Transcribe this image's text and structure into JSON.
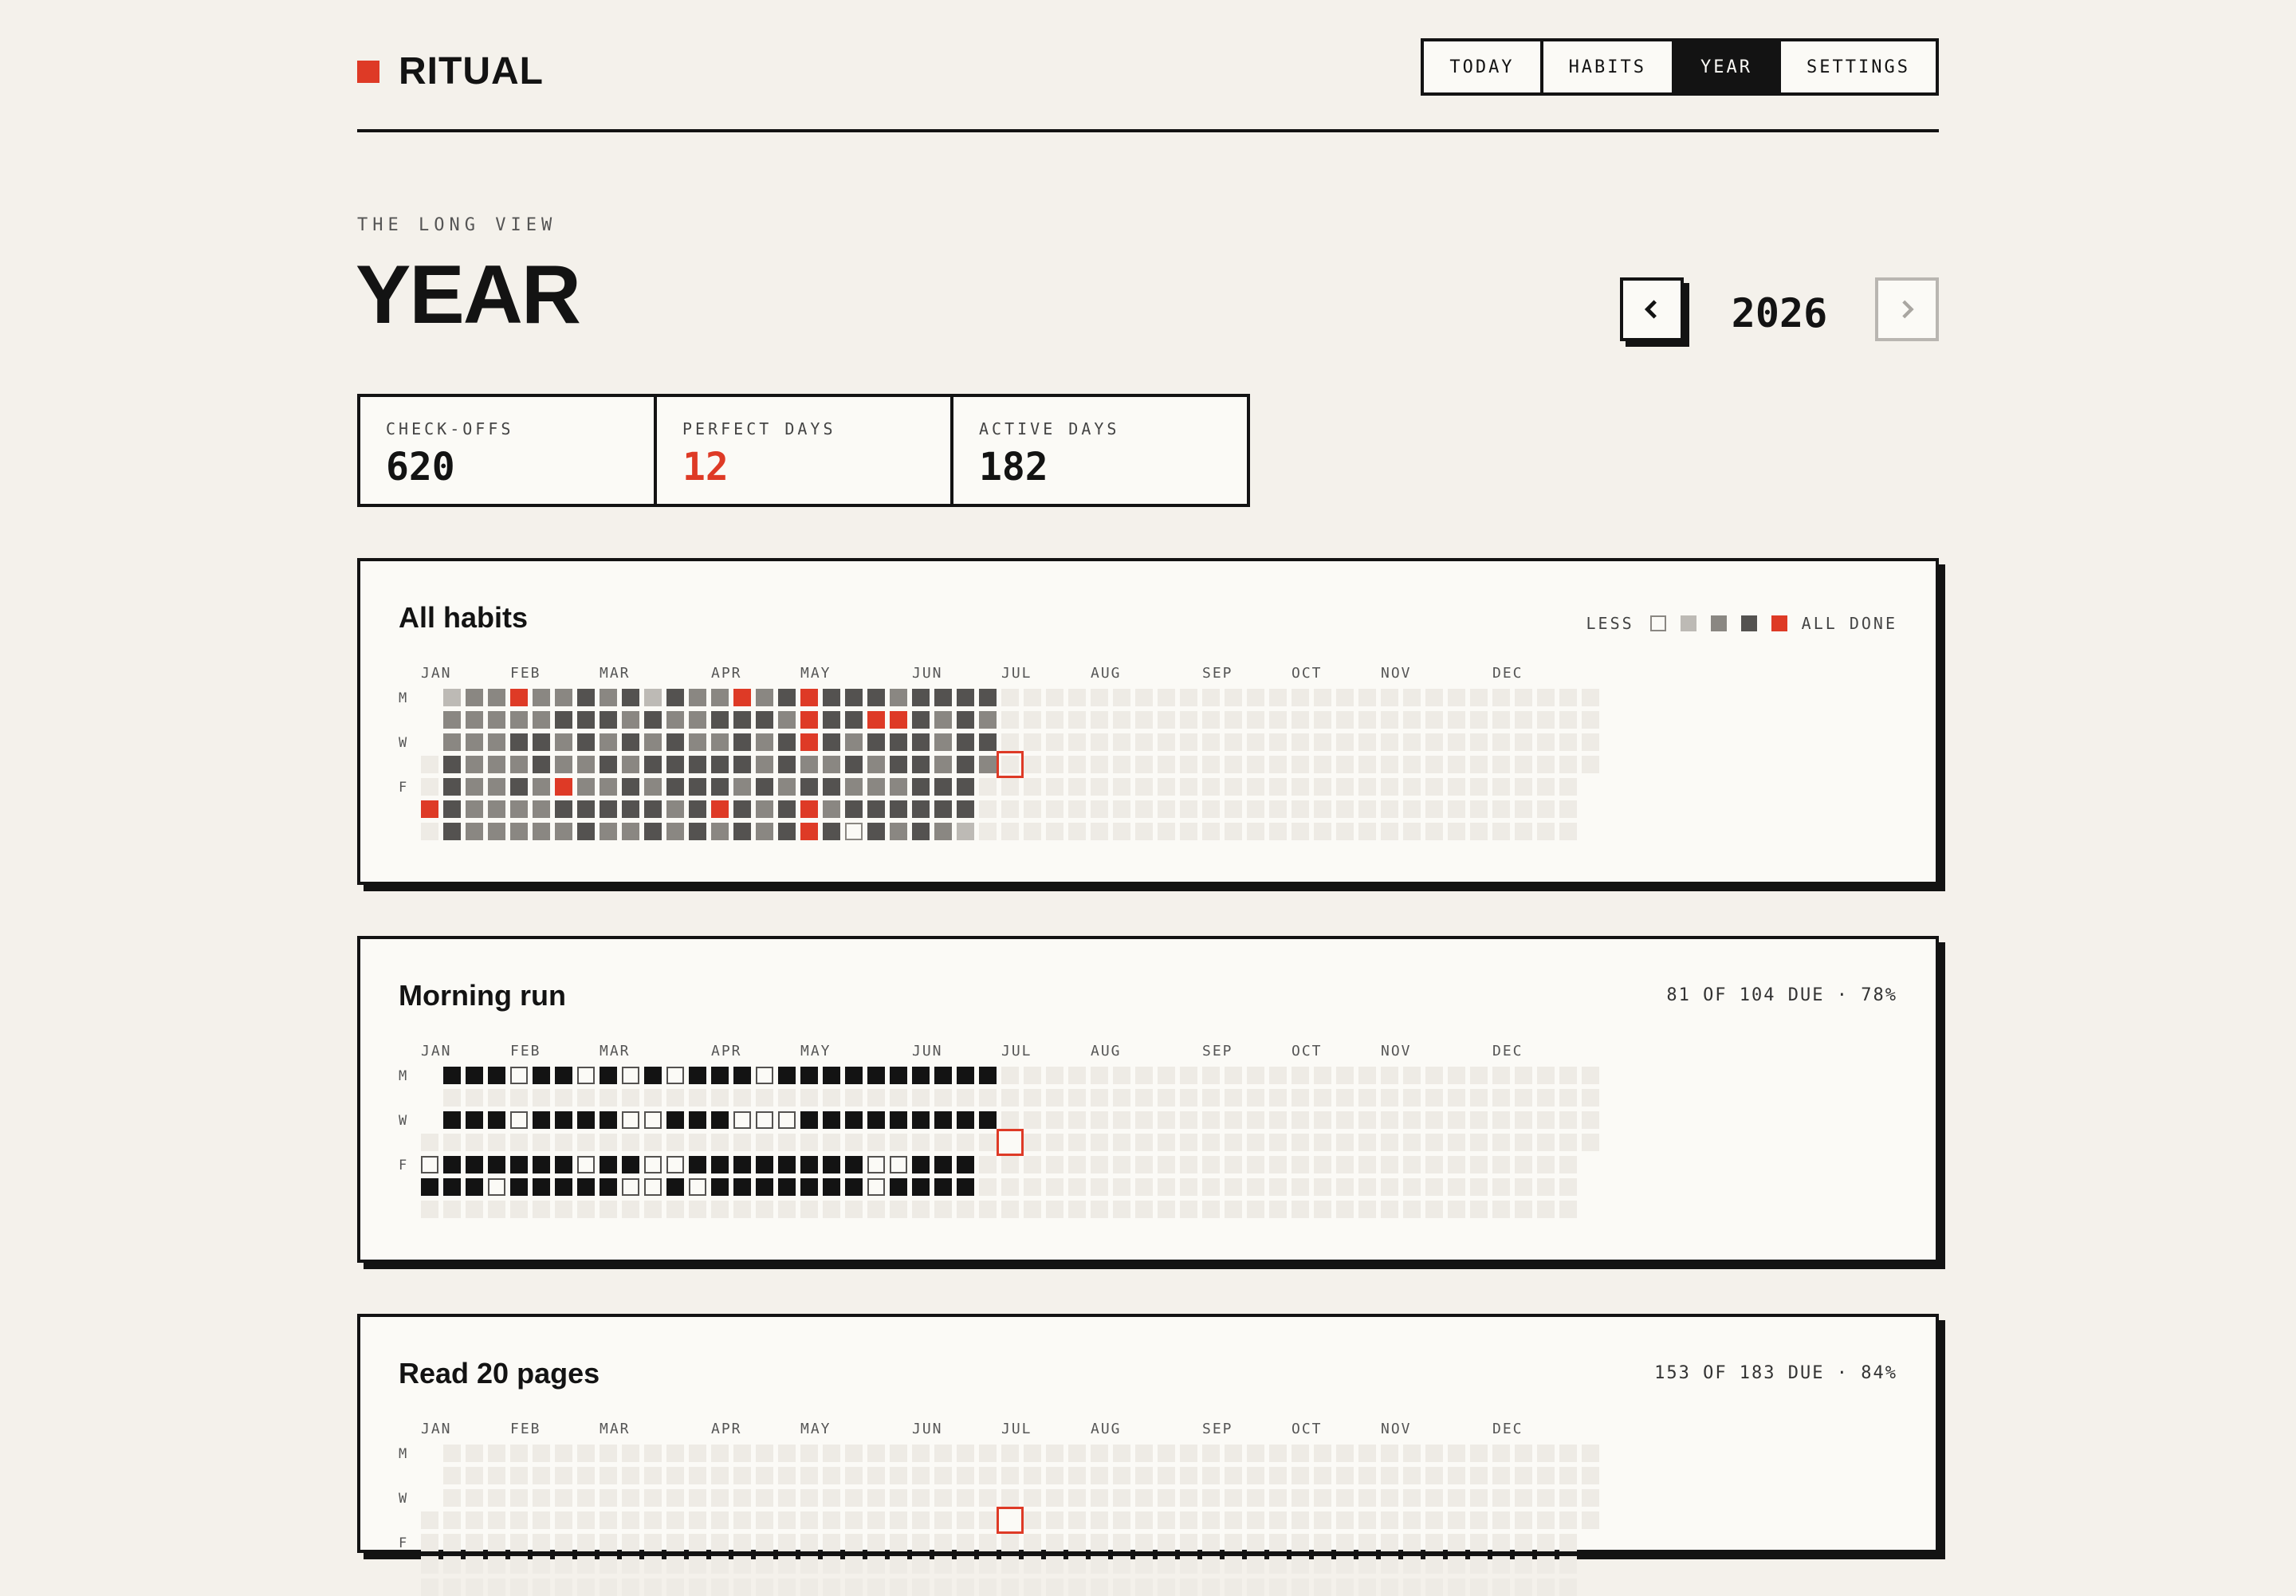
{
  "app": {
    "name": "RITUAL",
    "brand_color": "#de3a26"
  },
  "nav": [
    {
      "label": "TODAY",
      "active": false
    },
    {
      "label": "HABITS",
      "active": false
    },
    {
      "label": "YEAR",
      "active": true
    },
    {
      "label": "SETTINGS",
      "active": false
    }
  ],
  "page": {
    "eyebrow": "THE LONG VIEW",
    "title": "YEAR"
  },
  "year_nav": {
    "year": "2026",
    "prev_icon": "chevron-left-icon",
    "next_icon": "chevron-right-icon"
  },
  "stats": [
    {
      "label": "CHECK-OFFS",
      "value": "620",
      "accent": false
    },
    {
      "label": "PERFECT DAYS",
      "value": "12",
      "accent": true
    },
    {
      "label": "ACTIVE DAYS",
      "value": "182",
      "accent": false
    }
  ],
  "calendar": {
    "months": [
      "JAN",
      "FEB",
      "MAR",
      "APR",
      "MAY",
      "JUN",
      "JUL",
      "AUG",
      "SEP",
      "OCT",
      "NOV",
      "DEC"
    ],
    "day_labels": [
      "M",
      "",
      "W",
      "",
      "F",
      "",
      ""
    ],
    "today": {
      "week": 26,
      "day": 3
    }
  },
  "legend": {
    "less": "LESS",
    "more": "ALL DONE",
    "levels": [
      "#fbfaf6",
      "#bdbab5",
      "#8a8782",
      "#545250",
      "#de3a26"
    ]
  },
  "colors": {
    "none": "#fbfaf6",
    "future": "#eeebe5",
    "done": "#131313",
    "accent": "#de3a26"
  },
  "cards": [
    {
      "title": "All habits",
      "kind": "summary",
      "levels": [
        "..1..4.",
        "1223333",
        "2222222",
        "2222222",
        "4232322",
        "2233222",
        "2322432",
        "3332233",
        "2323232",
        "3232332",
        "1323233",
        "3233322",
        "2223333",
        "2323342",
        "4333233",
        "2322322",
        "3233233",
        "4442344",
        "3332323",
        "3323230",
        "3432233",
        "2433232",
        "3333333",
        "3222332",
        "3333331",
        "3232",
        "...."
      ]
    },
    {
      "title": "Morning run",
      "kind": "habit",
      "meta": "81 OF 104 DUE · 78%",
      "days": [
        0,
        2,
        4,
        5
      ],
      "checks": [
        "..01",
        "1111",
        "1111",
        "1110",
        "0011",
        "1111",
        "1111",
        "0101",
        "1111",
        "0010",
        "1000",
        "0101",
        "1110",
        "1111",
        "1011",
        "0011",
        "1011",
        "1111",
        "1111",
        "1111",
        "1100",
        "1101",
        "1111",
        "1111",
        "1111",
        "11",
        ".."
      ]
    },
    {
      "title": "Read 20 pages",
      "kind": "habit",
      "meta": "153 OF 183 DUE · 84%",
      "days": [
        0,
        1,
        2,
        3,
        4,
        5,
        6
      ],
      "checks": []
    }
  ]
}
